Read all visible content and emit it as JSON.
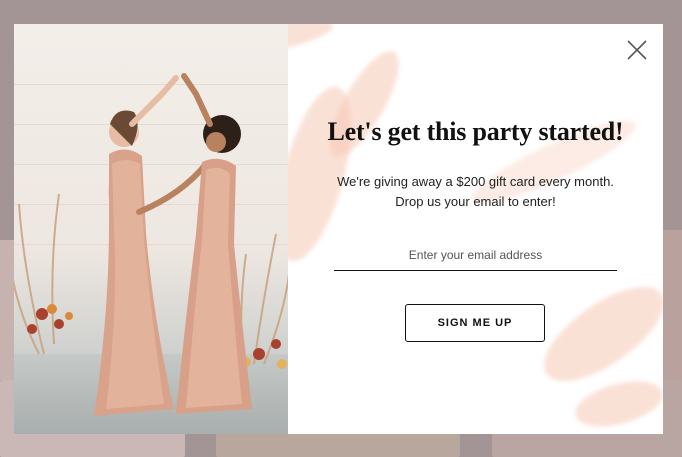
{
  "modal": {
    "headline": "Let's get this party started!",
    "subtext": "We're giving away a $200 gift card every month. Drop us your email to enter!",
    "email": {
      "value": "",
      "placeholder": "Enter your email address"
    },
    "signup_label": "SIGN ME UP",
    "close_icon": "close-icon",
    "accent_color": "#f7c9b6"
  }
}
